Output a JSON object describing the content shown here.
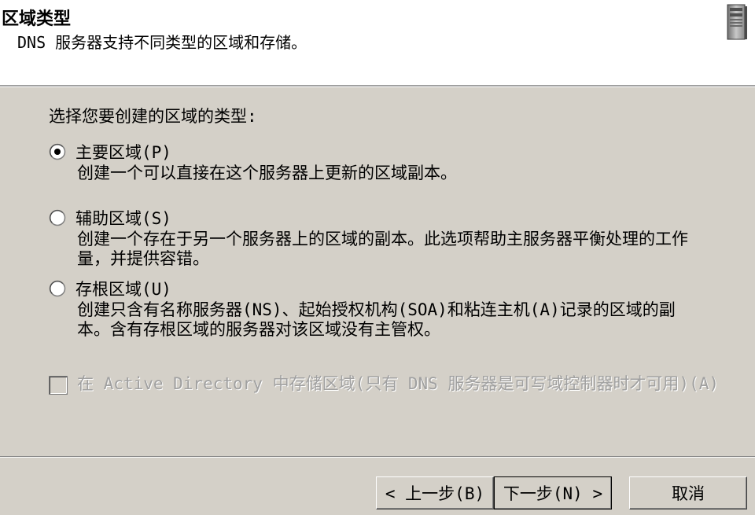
{
  "header": {
    "title": "区域类型",
    "subtitle": "DNS 服务器支持不同类型的区域和存储。",
    "icon": "server-icon"
  },
  "prompt": "选择您要创建的区域的类型:",
  "options": [
    {
      "label": "主要区域(P)",
      "description": "创建一个可以直接在这个服务器上更新的区域副本。",
      "selected": true
    },
    {
      "label": "辅助区域(S)",
      "description": "创建一个存在于另一个服务器上的区域的副本。此选项帮助主服务器平衡处理的工作量，并提供容错。",
      "selected": false
    },
    {
      "label": "存根区域(U)",
      "description": "创建只含有名称服务器(NS)、起始授权机构(SOA)和粘连主机(A)记录的区域的副本。含有存根区域的服务器对该区域没有主管权。",
      "selected": false
    }
  ],
  "ad_checkbox": {
    "label": "在 Active Directory 中存储区域(只有 DNS 服务器是可写域控制器时才可用)(A)",
    "checked": false,
    "disabled": true
  },
  "buttons": {
    "back": "< 上一步(B)",
    "next": "下一步(N) >",
    "cancel": "取消"
  },
  "colors": {
    "dialog_bg": "#d4d0c8",
    "header_bg": "#ffffff",
    "disabled_text": "#a0a0a0"
  }
}
